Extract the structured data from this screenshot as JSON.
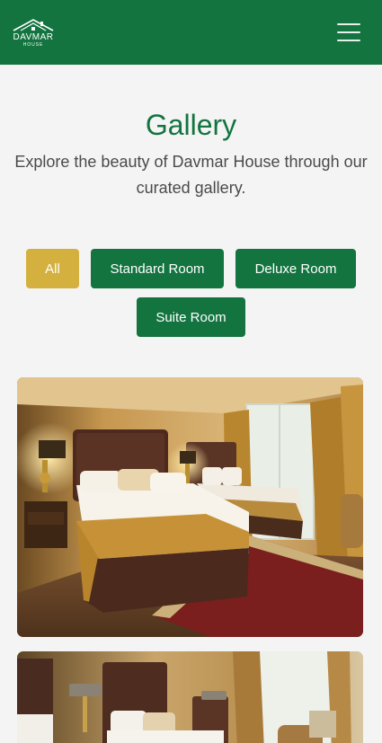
{
  "brand": {
    "name": "DAVMAR",
    "sub": "HOUSE"
  },
  "gallery": {
    "title": "Gallery",
    "subtitle": "Explore the beauty of Davmar House through our curated gallery."
  },
  "filters": [
    {
      "label": "All",
      "active": true
    },
    {
      "label": "Standard Room",
      "active": false
    },
    {
      "label": "Deluxe Room",
      "active": false
    },
    {
      "label": "Suite Room",
      "active": false
    }
  ],
  "colors": {
    "brand_green": "#137440",
    "active_gold": "#d4b13f",
    "background": "#f4f4f4"
  },
  "icons": {
    "menu": "hamburger-menu-icon",
    "logo": "house-roof-icon"
  }
}
